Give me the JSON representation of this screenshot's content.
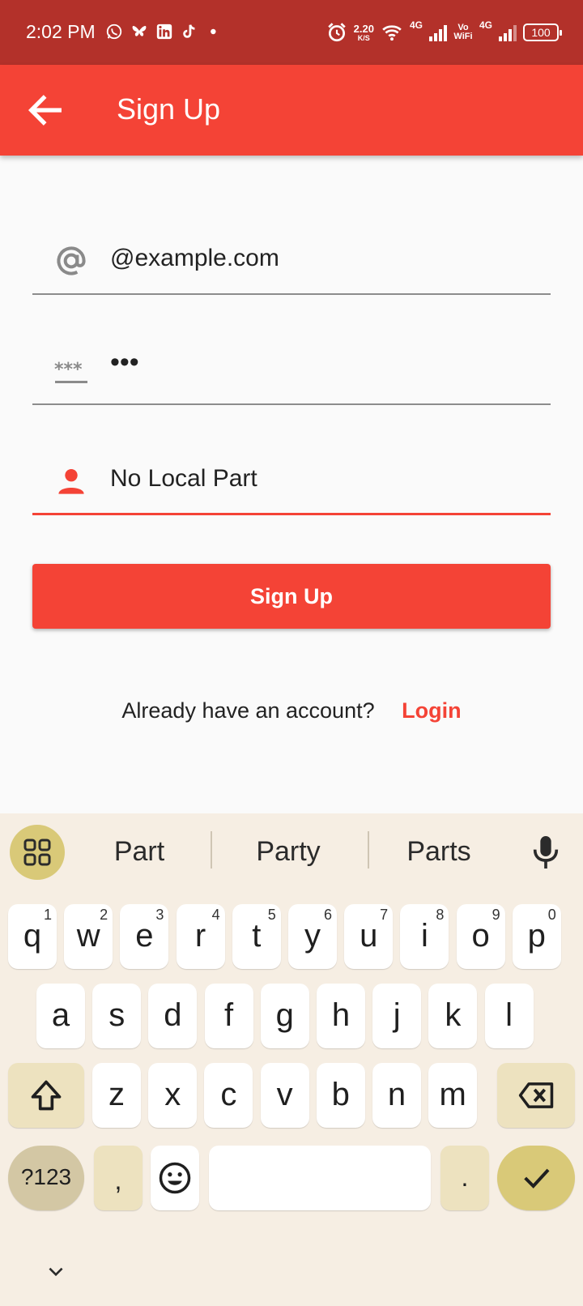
{
  "status_bar": {
    "time": "2:02 PM",
    "net_speed_value": "2.20",
    "net_speed_unit": "K/S",
    "lte1": "4G",
    "vowifi": "Vo WiFi",
    "lte2": "4G",
    "battery": "100"
  },
  "app_bar": {
    "title": "Sign Up"
  },
  "form": {
    "email_value": "@example.com",
    "password_value": "•••",
    "name_value": "No Local Part",
    "signup_label": "Sign Up",
    "login_prompt": "Already have an account?",
    "login_link": "Login"
  },
  "keyboard": {
    "suggestions": [
      "Part",
      "Party",
      "Parts"
    ],
    "row1": [
      {
        "k": "q",
        "h": "1"
      },
      {
        "k": "w",
        "h": "2"
      },
      {
        "k": "e",
        "h": "3"
      },
      {
        "k": "r",
        "h": "4"
      },
      {
        "k": "t",
        "h": "5"
      },
      {
        "k": "y",
        "h": "6"
      },
      {
        "k": "u",
        "h": "7"
      },
      {
        "k": "i",
        "h": "8"
      },
      {
        "k": "o",
        "h": "9"
      },
      {
        "k": "p",
        "h": "0"
      }
    ],
    "row2": [
      "a",
      "s",
      "d",
      "f",
      "g",
      "h",
      "j",
      "k",
      "l"
    ],
    "row3": [
      "z",
      "x",
      "c",
      "v",
      "b",
      "n",
      "m"
    ],
    "symbols_label": "?123",
    "comma": ",",
    "period": "."
  },
  "colors": {
    "status_bar": "#b3312a",
    "accent": "#f44336",
    "keyboard_bg": "#f6eee3",
    "key_modifier": "#ede2bf",
    "key_action": "#d9c978"
  }
}
